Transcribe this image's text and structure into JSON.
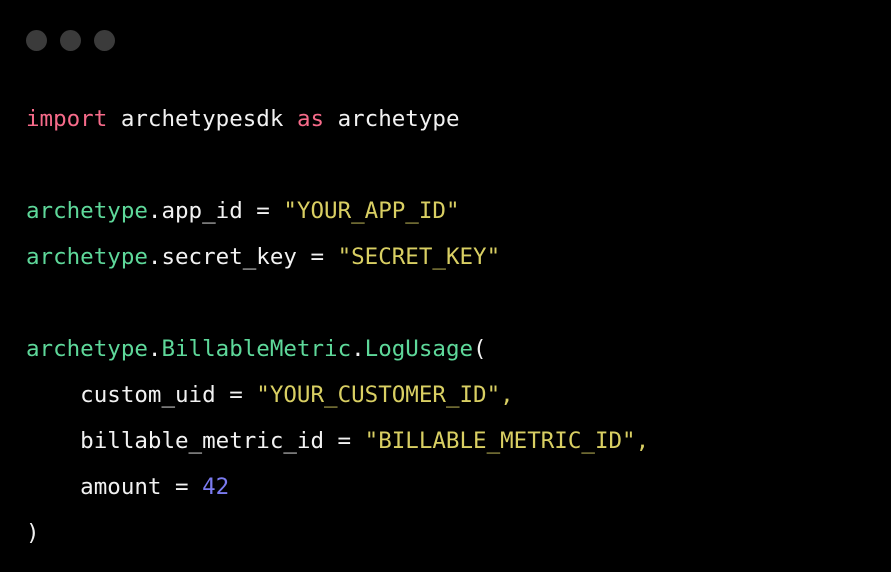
{
  "window": {
    "background_color": "#000000",
    "dots": [
      {
        "name": "close-dot",
        "color": "#3b3b3b"
      },
      {
        "name": "minimize-dot",
        "color": "#3b3b3b"
      },
      {
        "name": "maximize-dot",
        "color": "#3b3b3b"
      }
    ]
  },
  "theme": {
    "keyword_color": "#f76b8a",
    "module_color": "#5ed89a",
    "class_color": "#5ed89a",
    "function_color": "#5ed89a",
    "string_color": "#d9cf63",
    "number_color": "#7b7bf0",
    "plain_color": "#f2f2f2",
    "background_color": "#000000"
  },
  "code": {
    "language": "python",
    "lines": [
      {
        "index": 1,
        "text": "import archetypesdk as archetype",
        "tokens": [
          {
            "t": "import",
            "k": "keyword"
          },
          {
            "t": " ",
            "k": "plain"
          },
          {
            "t": "archetypesdk",
            "k": "plain"
          },
          {
            "t": " ",
            "k": "plain"
          },
          {
            "t": "as",
            "k": "keyword"
          },
          {
            "t": " ",
            "k": "plain"
          },
          {
            "t": "archetype",
            "k": "plain"
          }
        ]
      },
      {
        "index": 2,
        "text": "",
        "tokens": []
      },
      {
        "index": 3,
        "text": "archetype.app_id = \"YOUR_APP_ID\"",
        "tokens": [
          {
            "t": "archetype",
            "k": "module"
          },
          {
            "t": ".app_id",
            "k": "plain"
          },
          {
            "t": " = ",
            "k": "op"
          },
          {
            "t": "\"YOUR_APP_ID\"",
            "k": "string"
          }
        ]
      },
      {
        "index": 4,
        "text": "archetype.secret_key = \"SECRET_KEY\"",
        "tokens": [
          {
            "t": "archetype",
            "k": "module"
          },
          {
            "t": ".secret_key",
            "k": "plain"
          },
          {
            "t": " = ",
            "k": "op"
          },
          {
            "t": "\"SECRET_KEY\"",
            "k": "string"
          }
        ]
      },
      {
        "index": 5,
        "text": "",
        "tokens": []
      },
      {
        "index": 6,
        "text": "archetype.BillableMetric.LogUsage(",
        "tokens": [
          {
            "t": "archetype",
            "k": "module"
          },
          {
            "t": ".",
            "k": "punct"
          },
          {
            "t": "BillableMetric",
            "k": "class"
          },
          {
            "t": ".",
            "k": "punct"
          },
          {
            "t": "LogUsage",
            "k": "func"
          },
          {
            "t": "(",
            "k": "punct"
          }
        ]
      },
      {
        "index": 7,
        "text": "    custom_uid = \"YOUR_CUSTOMER_ID\",",
        "tokens": [
          {
            "t": "    custom_uid",
            "k": "plain"
          },
          {
            "t": " = ",
            "k": "op"
          },
          {
            "t": "\"YOUR_CUSTOMER_ID\",",
            "k": "string"
          }
        ]
      },
      {
        "index": 8,
        "text": "    billable_metric_id = \"BILLABLE_METRIC_ID\",",
        "tokens": [
          {
            "t": "    billable_metric_id",
            "k": "plain"
          },
          {
            "t": " = ",
            "k": "op"
          },
          {
            "t": "\"BILLABLE_METRIC_ID\",",
            "k": "string"
          }
        ]
      },
      {
        "index": 9,
        "text": "    amount = 42",
        "tokens": [
          {
            "t": "    amount",
            "k": "plain"
          },
          {
            "t": " = ",
            "k": "op"
          },
          {
            "t": "42",
            "k": "number"
          }
        ]
      },
      {
        "index": 10,
        "text": ")",
        "tokens": [
          {
            "t": ")",
            "k": "punct"
          }
        ]
      }
    ]
  }
}
